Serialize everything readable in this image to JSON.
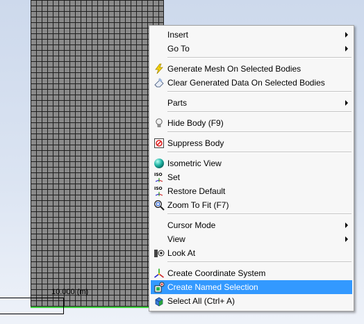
{
  "viewport": {
    "scale_label": "10.000 (m)"
  },
  "menu": {
    "items": [
      {
        "label": "Insert"
      },
      {
        "label": "Go To"
      },
      {
        "label": "Generate Mesh On Selected Bodies"
      },
      {
        "label": "Clear Generated Data On Selected Bodies"
      },
      {
        "label": "Parts"
      },
      {
        "label": "Hide Body (F9)"
      },
      {
        "label": "Suppress Body"
      },
      {
        "label": "Isometric View"
      },
      {
        "label": "Set"
      },
      {
        "label": "Restore Default"
      },
      {
        "label": "Zoom To Fit (F7)"
      },
      {
        "label": "Cursor Mode"
      },
      {
        "label": "View"
      },
      {
        "label": "Look At"
      },
      {
        "label": "Create Coordinate System"
      },
      {
        "label": "Create Named Selection"
      },
      {
        "label": "Select All (Ctrl+ A)"
      }
    ],
    "highlighted_item": "Create Named Selection",
    "highlight_color": "#3399ff"
  }
}
